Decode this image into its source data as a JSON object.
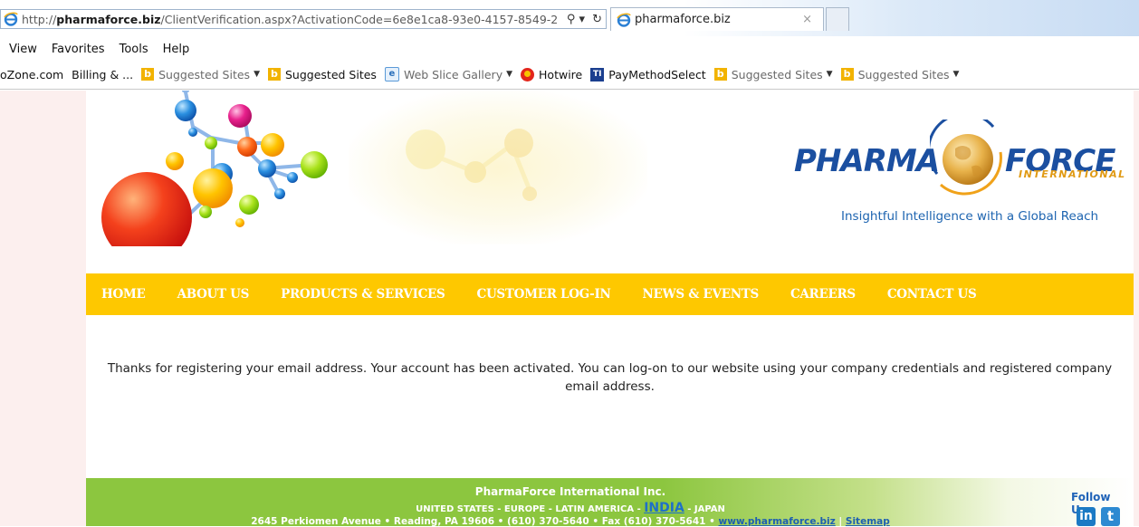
{
  "browser": {
    "url_prefix": "http://",
    "url_domain": "pharmaforce.biz",
    "url_rest": "/ClientVerification.aspx?ActivationCode=6e8e1ca8-93e0-4157-8549-2",
    "search_glyph": "⚲ ▾",
    "refresh_glyph": "↻",
    "tab_title": "pharmaforce.biz",
    "tab_close": "×",
    "menu": [
      "View",
      "Favorites",
      "Tools",
      "Help"
    ],
    "favorites": [
      {
        "label": "oZone.com",
        "icon": "none",
        "dim": false,
        "caret": false
      },
      {
        "label": "Billing & ...",
        "icon": "none",
        "dim": false,
        "caret": false
      },
      {
        "label": "Suggested Sites",
        "icon": "bing-icon",
        "dim": true,
        "caret": true
      },
      {
        "label": "Suggested Sites",
        "icon": "bing-icon",
        "dim": false,
        "caret": false
      },
      {
        "label": "Web Slice Gallery",
        "icon": "web-slice-icon",
        "dim": true,
        "caret": true
      },
      {
        "label": "Hotwire",
        "icon": "hotwire-icon",
        "dim": false,
        "caret": false
      },
      {
        "label": "PayMethodSelect",
        "icon": "paymethod-icon",
        "dim": false,
        "caret": false
      },
      {
        "label": "Suggested Sites",
        "icon": "bing-icon",
        "dim": true,
        "caret": true
      },
      {
        "label": "Suggested Sites",
        "icon": "bing-icon",
        "dim": true,
        "caret": true
      }
    ]
  },
  "site": {
    "logo_left": "PHARMA",
    "logo_right": "FORCE",
    "logo_sub": "INTERNATIONAL",
    "tagline": "Insightful Intelligence with a Global Reach",
    "search_value": "",
    "nav": [
      "HOME",
      "ABOUT US",
      "PRODUCTS & SERVICES",
      "CUSTOMER LOG-IN",
      "NEWS & EVENTS",
      "CAREERS",
      "CONTACT US"
    ],
    "message": "Thanks for registering your email address. Your account has been activated. You can log-on to our website using your company credentials and registered company email address.",
    "footer": {
      "company": "PharmaForce International Inc.",
      "regions_before": "UNITED STATES - EUROPE - LATIN AMERICA - ",
      "regions_highlight": "INDIA",
      "regions_after": " - JAPAN",
      "address": "2645 Perkiomen Avenue • Reading, PA 19606 • (610) 370-5640 • Fax (610) 370-5641 • ",
      "website": "www.pharmaforce.biz",
      "separator": " | ",
      "sitemap": "Sitemap",
      "follow_us": "Follow Us:",
      "linkedin": "in",
      "twitter": "t"
    }
  },
  "colors": {
    "nav_bg": "#fec800",
    "footer_green": "#8cc63f",
    "logo_blue": "#1b4fa0",
    "accent_orange": "#e09a14"
  }
}
